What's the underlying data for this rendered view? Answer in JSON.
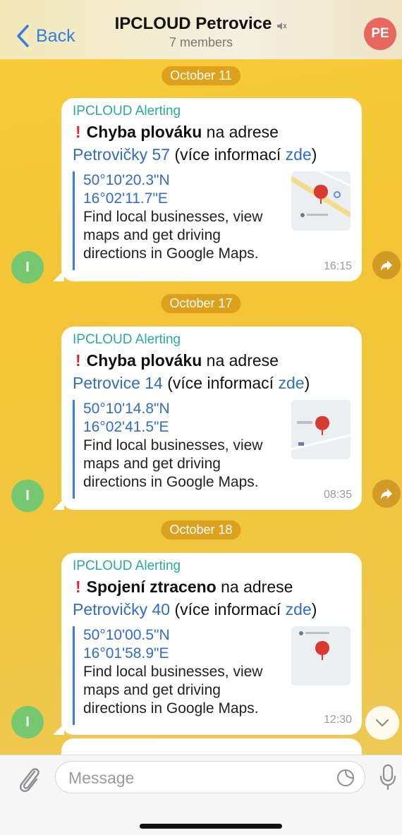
{
  "header": {
    "back_label": "Back",
    "title": "IPCLOUD Petrovice",
    "subtitle": "7 members",
    "avatar_initials": "PE"
  },
  "messages": [
    {
      "date": "October 11",
      "sender": "IPCLOUD Alerting",
      "alert_bold": "Chyba plováku",
      "alert_rest": "na adrese",
      "address": "Petrovičky 57",
      "info_prefix": "(více informací",
      "info_link": "zde",
      "info_suffix": ")",
      "lat": "50°10'20.3\"N",
      "lon": "16°02'11.7\"E",
      "preview_desc": "Find local businesses, view maps and get driving directions in Google Maps.",
      "time": "16:15",
      "avatar_initial": "I"
    },
    {
      "date": "October 17",
      "sender": "IPCLOUD Alerting",
      "alert_bold": "Chyba plováku",
      "alert_rest": "na adrese",
      "address": "Petrovice 14",
      "info_prefix": "(více informací",
      "info_link": "zde",
      "info_suffix": ")",
      "lat": "50°10'14.8\"N",
      "lon": "16°02'41.5\"E",
      "preview_desc": "Find local businesses, view maps and get driving directions in Google Maps.",
      "time": "08:35",
      "avatar_initial": "I"
    },
    {
      "date": "October 18",
      "sender": "IPCLOUD Alerting",
      "alert_bold": "Spojení ztraceno",
      "alert_rest": "na adrese",
      "address": "Petrovičky 40",
      "info_prefix": "(více informací",
      "info_link": "zde",
      "info_suffix": ")",
      "lat": "50°10'00.5\"N",
      "lon": "16°01'58.9\"E",
      "preview_desc": "Find local businesses, view maps and get driving directions in Google Maps.",
      "time": "12:30",
      "avatar_initial": "I"
    }
  ],
  "composer": {
    "placeholder": "Message"
  },
  "colors": {
    "accent": "#3a7de0",
    "sender": "#2aa9a1",
    "alert": "#e3262c",
    "chat_bg": "#f3c536"
  }
}
